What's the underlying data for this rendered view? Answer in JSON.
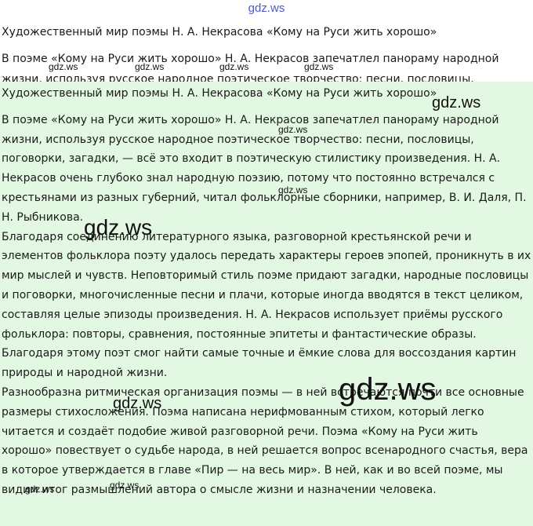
{
  "header": {
    "site": "gdz.ws"
  },
  "top_fragment": {
    "title": "Художественный мир поэмы Н. А. Некрасова «Кому на Руси жить хорошо»",
    "line1": "В поэме «Кому на Руси жить хорошо» Н. А. Некрасов запечатлел панораму народной",
    "line2": "жизни, используя русское народное поэтическое творчество: песни, пословицы,"
  },
  "article": {
    "title": "Художественный мир поэмы Н. А. Некрасова «Кому на Руси жить хорошо»",
    "paragraphs": [
      "В поэме «Кому на Руси жить хорошо» Н. А. Некрасов запечатлел панораму народной жизни, используя русское народное поэтическое творчество: песни, пословицы, поговорки, загадки, — всё это входит в поэтическую стилистику произведения. Н. А. Некрасов очень глубоко знал народную поэзию, потому что постоянно встречался с крестьянами из разных губерний, читал фольклорные сборники, например, В. И. Даля, П. Н. Рыбникова.",
      "Благодаря соединению литературного языка, разговорной крестьянской речи и элементов фольклора поэту удалось передать характеры героев эпопей, проникнуть в их мир мыслей и чувств. Неповторимый стиль поэме придают загадки, народные пословицы и поговорки, многочисленные песни и плачи, которые иногда вводятся в текст целиком, составляя целые эпизоды произведения. Н. А. Некрасов использует приёмы русского фольклора: повторы, сравнения, постоянные эпитеты и фантастические образы. Благодаря этому поэт смог найти самые точные и ёмкие слова для воссоздания картин природы и народной жизни.",
      "Разнообразна ритмическая организация поэмы — в ней встречаются почти все основные размеры стихосложения. Поэма написана нерифмованным стихом, который легко читается и создаёт подобие живой разговорной речи. Поэма «Кому на Руси жить хорошо» повествует о судьбе народа, в ней решается вопрос всенародного счастья, вера в которое утверждается в главе «Пир — на весь мир». В ней, как и во всей поэме, мы видим итог размышлений автора о смысле жизни и назначении человека."
    ]
  },
  "watermarks": {
    "text": "gdz.ws"
  }
}
